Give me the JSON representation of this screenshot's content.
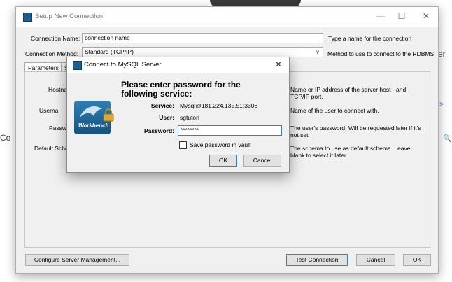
{
  "background": {
    "left_fragment": "Co",
    "right_fragment_1": "er",
    "right_fragment_2": ">",
    "right_fragment_3": "🔍"
  },
  "window": {
    "title": "Setup New Connection",
    "minimize": "—",
    "maximize": "☐",
    "close": "✕",
    "connection_name_label": "Connection Name:",
    "connection_name_value": "connection name",
    "connection_name_hint": "Type a name for the connection",
    "connection_method_label": "Connection Method:",
    "connection_method_value": "Standard (TCP/IP)",
    "connection_method_hint": "Method to use to connect to the RDBMS",
    "tabs": [
      "Parameters",
      "S"
    ],
    "params": {
      "hostname_label": "Hostna",
      "username_label": "Userna",
      "password_label": "Passwo",
      "default_schema_label": "Default Sche",
      "hostname_hint": "Name or IP address of the server host - and TCP/IP port.",
      "username_hint": "Name of the user to connect with.",
      "password_hint": "The user's password. Will be requested later if it's not set.",
      "schema_hint": "The schema to use as default schema. Leave blank to select it later."
    },
    "buttons": {
      "configure": "Configure Server Management...",
      "test": "Test Connection",
      "cancel": "Cancel",
      "ok": "OK"
    }
  },
  "dialog": {
    "title": "Connect to MySQL Server",
    "close": "✕",
    "heading": "Please enter password for the following service:",
    "logo_text": "Workbench",
    "service_label": "Service:",
    "service_value": "Mysql@181.224.135.51:3306",
    "user_label": "User:",
    "user_value": "sgtutori",
    "password_label": "Password:",
    "password_value": "********",
    "save_label": "Save password in vault",
    "save_checked": false,
    "ok": "OK",
    "cancel": "Cancel"
  }
}
